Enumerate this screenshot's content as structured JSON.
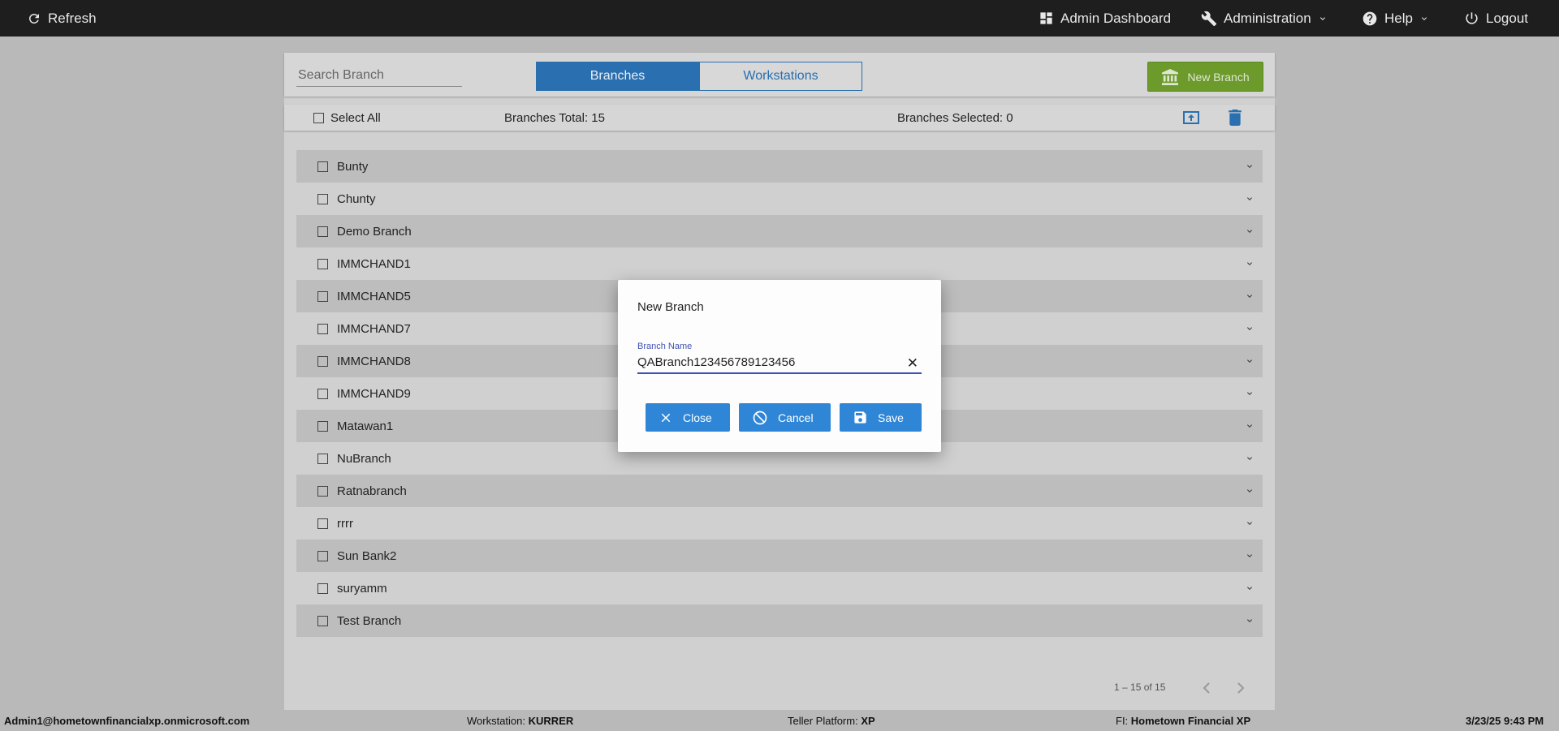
{
  "topbar": {
    "refresh_label": "Refresh",
    "admin_dashboard_label": "Admin Dashboard",
    "administration_label": "Administration",
    "help_label": "Help",
    "logout_label": "Logout"
  },
  "toolbar": {
    "search_placeholder": "Search Branch",
    "tab_branches": "Branches",
    "tab_workstations": "Workstations",
    "new_branch_label": "New Branch"
  },
  "selection": {
    "select_all_label": "Select All",
    "total_label": "Branches Total: 15",
    "selected_label": "Branches Selected: 0"
  },
  "branches": [
    "Bunty",
    "Chunty",
    "Demo Branch",
    "IMMCHAND1",
    "IMMCHAND5",
    "IMMCHAND7",
    "IMMCHAND8",
    "IMMCHAND9",
    "Matawan1",
    "NuBranch",
    "Ratnabranch",
    "rrrr",
    "Sun Bank2",
    "suryamm",
    "Test Branch"
  ],
  "pager": {
    "range_label": "1 – 15 of 15"
  },
  "dialog": {
    "title": "New Branch",
    "field_label": "Branch Name",
    "field_value": "QABranch123456789123456",
    "close_label": "Close",
    "cancel_label": "Cancel",
    "save_label": "Save"
  },
  "status": {
    "user": "Admin1@hometownfinancialxp.onmicrosoft.com",
    "workstation_label": "Workstation:",
    "workstation_value": "KURRER",
    "platform_label": "Teller Platform:",
    "platform_value": "XP",
    "fi_label": "FI:",
    "fi_value": "Hometown Financial XP",
    "datetime": "3/23/25 9:43 PM"
  },
  "colors": {
    "accent_blue": "#2a6fb0",
    "new_branch_green": "#6c9a2b",
    "dialog_button_blue": "#2f86d6",
    "field_underline": "#3f51b5"
  }
}
